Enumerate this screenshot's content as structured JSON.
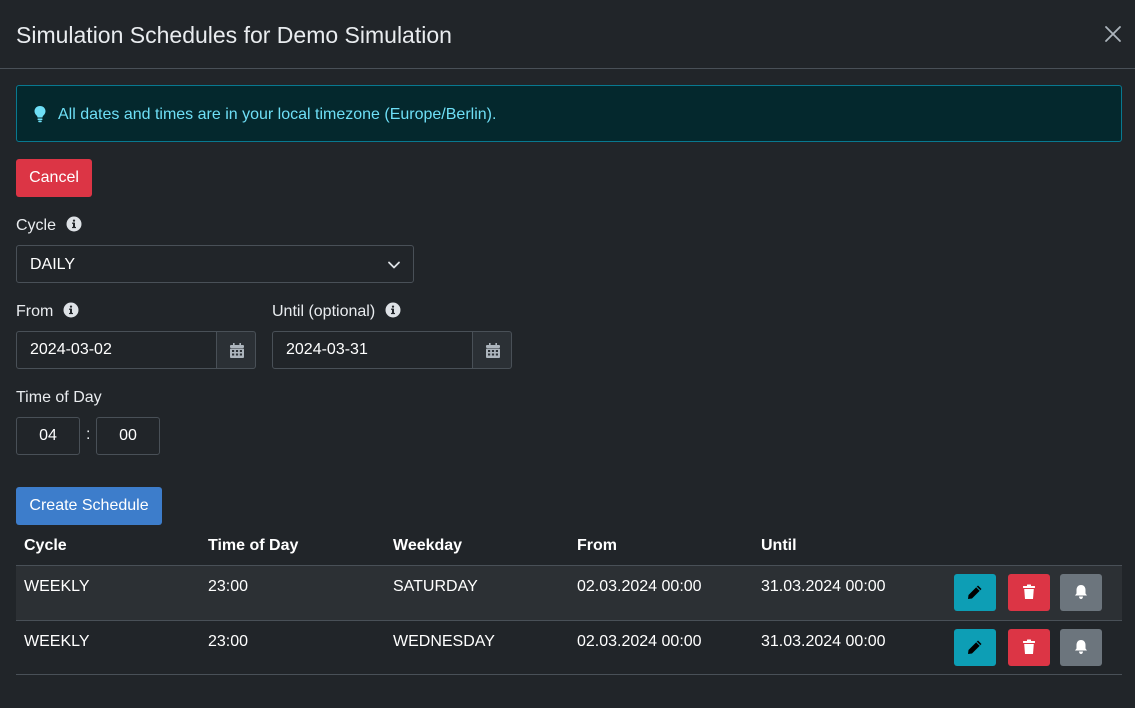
{
  "modal": {
    "title": "Simulation Schedules for Demo Simulation"
  },
  "alert": {
    "text": "All dates and times are in your local timezone (Europe/Berlin)."
  },
  "buttons": {
    "cancel": "Cancel",
    "create": "Create Schedule"
  },
  "form": {
    "cycle_label": "Cycle",
    "cycle_value": "DAILY",
    "from_label": "From",
    "from_value": "2024-03-02",
    "until_label": "Until (optional)",
    "until_value": "2024-03-31",
    "time_label": "Time of Day",
    "time_hour": "04",
    "time_minute": "00",
    "time_separator": ":"
  },
  "table": {
    "headers": [
      "Cycle",
      "Time of Day",
      "Weekday",
      "From",
      "Until"
    ],
    "rows": [
      {
        "cycle": "WEEKLY",
        "time": "23:00",
        "weekday": "SATURDAY",
        "from": "02.03.2024 00:00",
        "until": "31.03.2024 00:00"
      },
      {
        "cycle": "WEEKLY",
        "time": "23:00",
        "weekday": "WEDNESDAY",
        "from": "02.03.2024 00:00",
        "until": "31.03.2024 00:00"
      }
    ]
  },
  "icons": {
    "close": "close-icon",
    "alert": "lightbulb-icon",
    "info": "info-circle-icon",
    "chevron": "chevron-down-icon",
    "calendar": "calendar-icon",
    "edit": "pencil-icon",
    "delete": "trash-icon",
    "notify": "bell-icon"
  },
  "colors": {
    "background": "#212529",
    "danger": "#dc3545",
    "primary": "#3d7dcb",
    "info": "#0d9eb5",
    "secondary": "#6c757d",
    "alert_text": "#6edff6"
  }
}
